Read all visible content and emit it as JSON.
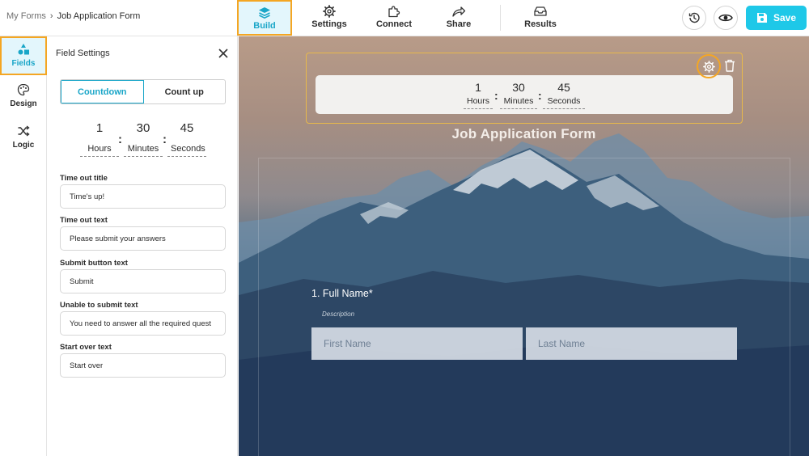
{
  "breadcrumb": {
    "root": "My Forms",
    "separator": "›",
    "current": "Job Application Form"
  },
  "nav": {
    "tabs": [
      {
        "label": "Build",
        "icon": "layers-icon",
        "active": true
      },
      {
        "label": "Settings",
        "icon": "gear-icon"
      },
      {
        "label": "Connect",
        "icon": "puzzle-icon"
      },
      {
        "label": "Share",
        "icon": "share-arrow-icon"
      },
      {
        "label": "Results",
        "icon": "inbox-icon"
      }
    ],
    "save_label": "Save"
  },
  "sidebar": {
    "items": [
      {
        "label": "Fields",
        "icon": "shapes-icon",
        "active": true
      },
      {
        "label": "Design",
        "icon": "palette-icon"
      },
      {
        "label": "Logic",
        "icon": "shuffle-icon"
      }
    ]
  },
  "field_settings": {
    "title": "Field Settings",
    "mode_options": [
      "Countdown",
      "Count up"
    ],
    "selected_mode": "Countdown",
    "timer": {
      "hours": "1",
      "minutes": "30",
      "seconds": "45",
      "hours_label": "Hours",
      "minutes_label": "Minutes",
      "seconds_label": "Seconds",
      "colon": ":"
    },
    "fields": [
      {
        "label": "Time out title",
        "value": "Time's up!"
      },
      {
        "label": "Time out text",
        "value": "Please submit your answers"
      },
      {
        "label": "Submit button text",
        "value": "Submit"
      },
      {
        "label": "Unable to submit text",
        "value": "You need to answer all the required quest"
      },
      {
        "label": "Start over text",
        "value": "Start over"
      }
    ]
  },
  "form_preview": {
    "timer": {
      "hours": "1",
      "minutes": "30",
      "seconds": "45",
      "hours_label": "Hours",
      "minutes_label": "Minutes",
      "seconds_label": "Seconds",
      "colon": ":"
    },
    "title": "Job Application Form",
    "question": {
      "label": "1. Full Name*",
      "description": "Description",
      "first_placeholder": "First Name",
      "last_placeholder": "Last Name"
    }
  },
  "colors": {
    "accent": "#1aa6c8",
    "save_button": "#1ec8e8",
    "highlight": "#f4a623",
    "active_bg": "#e3f6fc"
  }
}
